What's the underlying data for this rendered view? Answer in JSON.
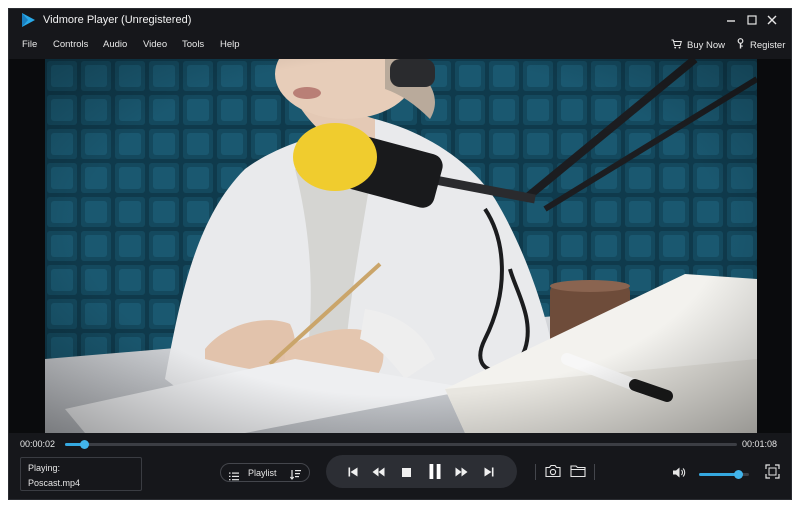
{
  "window": {
    "title": "Vidmore Player (Unregistered)"
  },
  "menu": {
    "items": [
      "File",
      "Controls",
      "Audio",
      "Video",
      "Tools",
      "Help"
    ],
    "buy_now": "Buy Now",
    "register": "Register"
  },
  "video": {
    "scene_icon": "video-frame-podcast"
  },
  "playback": {
    "current_time": "00:00:02",
    "total_time": "00:01:08",
    "progress": 0.028,
    "volume": 0.78
  },
  "now_playing": {
    "label": "Playing:",
    "file": "Poscast.mp4"
  },
  "playlist": {
    "label": "Playlist"
  },
  "colors": {
    "accent": "#35a8e0",
    "background": "#16171b",
    "transport_bg": "#2c2e34"
  },
  "icons": {
    "logo": "play-triangle-logo",
    "minimize": "minimize-icon",
    "maximize": "maximize-icon",
    "close": "close-icon",
    "cart": "cart-icon",
    "key": "key-icon",
    "playlist": "list-icon",
    "sort": "sort-icon",
    "previous": "skip-previous-icon",
    "rewind": "rewind-icon",
    "stop": "stop-icon",
    "pause": "pause-icon",
    "forward": "fast-forward-icon",
    "next": "skip-next-icon",
    "snapshot": "camera-icon",
    "folder": "folder-icon",
    "volume": "volume-icon",
    "fullscreen": "fullscreen-icon"
  }
}
